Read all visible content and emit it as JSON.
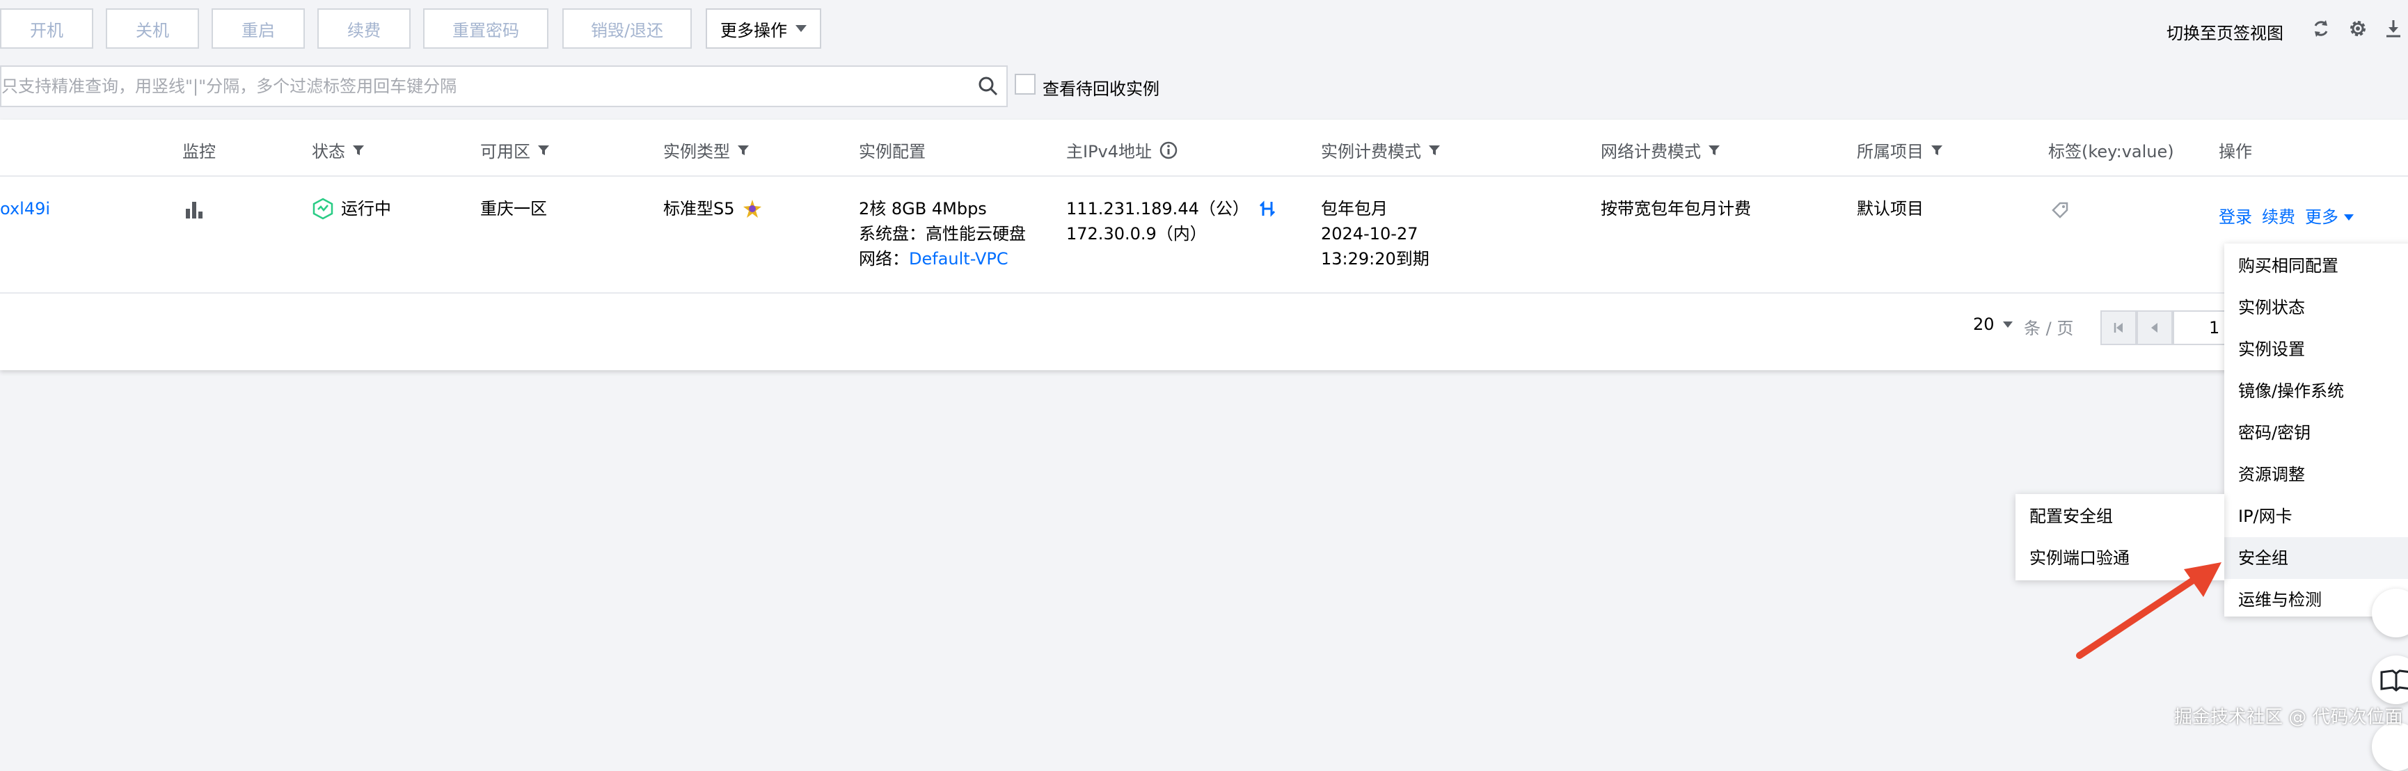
{
  "toolbar": {
    "buttons": [
      "开机",
      "关机",
      "重启",
      "续费",
      "重置密码",
      "销毁/退还"
    ],
    "more_label": "更多操作",
    "switch_view": "切换至页签视图"
  },
  "search": {
    "placeholder": "只支持精准查询，用竖线\"|\"分隔，多个过滤标签用回车键分隔",
    "recycle_label": "查看待回收实例"
  },
  "table": {
    "headers": {
      "id": "",
      "monitor": "监控",
      "status": "状态",
      "zone": "可用区",
      "type": "实例类型",
      "config": "实例配置",
      "ipv4": "主IPv4地址",
      "billing": "实例计费模式",
      "net_billing": "网络计费模式",
      "project": "所属项目",
      "tags": "标签(key:value)",
      "actions": "操作"
    },
    "row": {
      "id": "oxl49i",
      "status": "运行中",
      "zone": "重庆一区",
      "type": "标准型S5",
      "config_line1": "2核 8GB 4Mbps",
      "config_line2": "系统盘：高性能云硬盘",
      "config_net_label": "网络：",
      "config_net_link": "Default-VPC",
      "ip_public": "111.231.189.44（公）",
      "ip_private": "172.30.0.9（内）",
      "billing_line1": "包年包月",
      "billing_line2": "2024-10-27",
      "billing_line3": "13:29:20到期",
      "net_billing": "按带宽包年包月计费",
      "project": "默认项目",
      "action_login": "登录",
      "action_renew": "续费",
      "action_more": "更多"
    }
  },
  "pagination": {
    "page_size": "20",
    "unit": "条 / 页",
    "page": "1"
  },
  "dropdown": {
    "items": [
      "购买相同配置",
      "实例状态",
      "实例设置",
      "镜像/操作系统",
      "密码/密钥",
      "资源调整",
      "IP/网卡",
      "安全组",
      "运维与检测"
    ],
    "active": "安全组"
  },
  "submenu": {
    "items": [
      "配置安全组",
      "实例端口验通"
    ]
  },
  "watermark": "掘金技术社区 @ 代码次位面",
  "colors": {
    "link": "#006eff",
    "running": "#29cc85",
    "arrow": "#e8452c"
  }
}
